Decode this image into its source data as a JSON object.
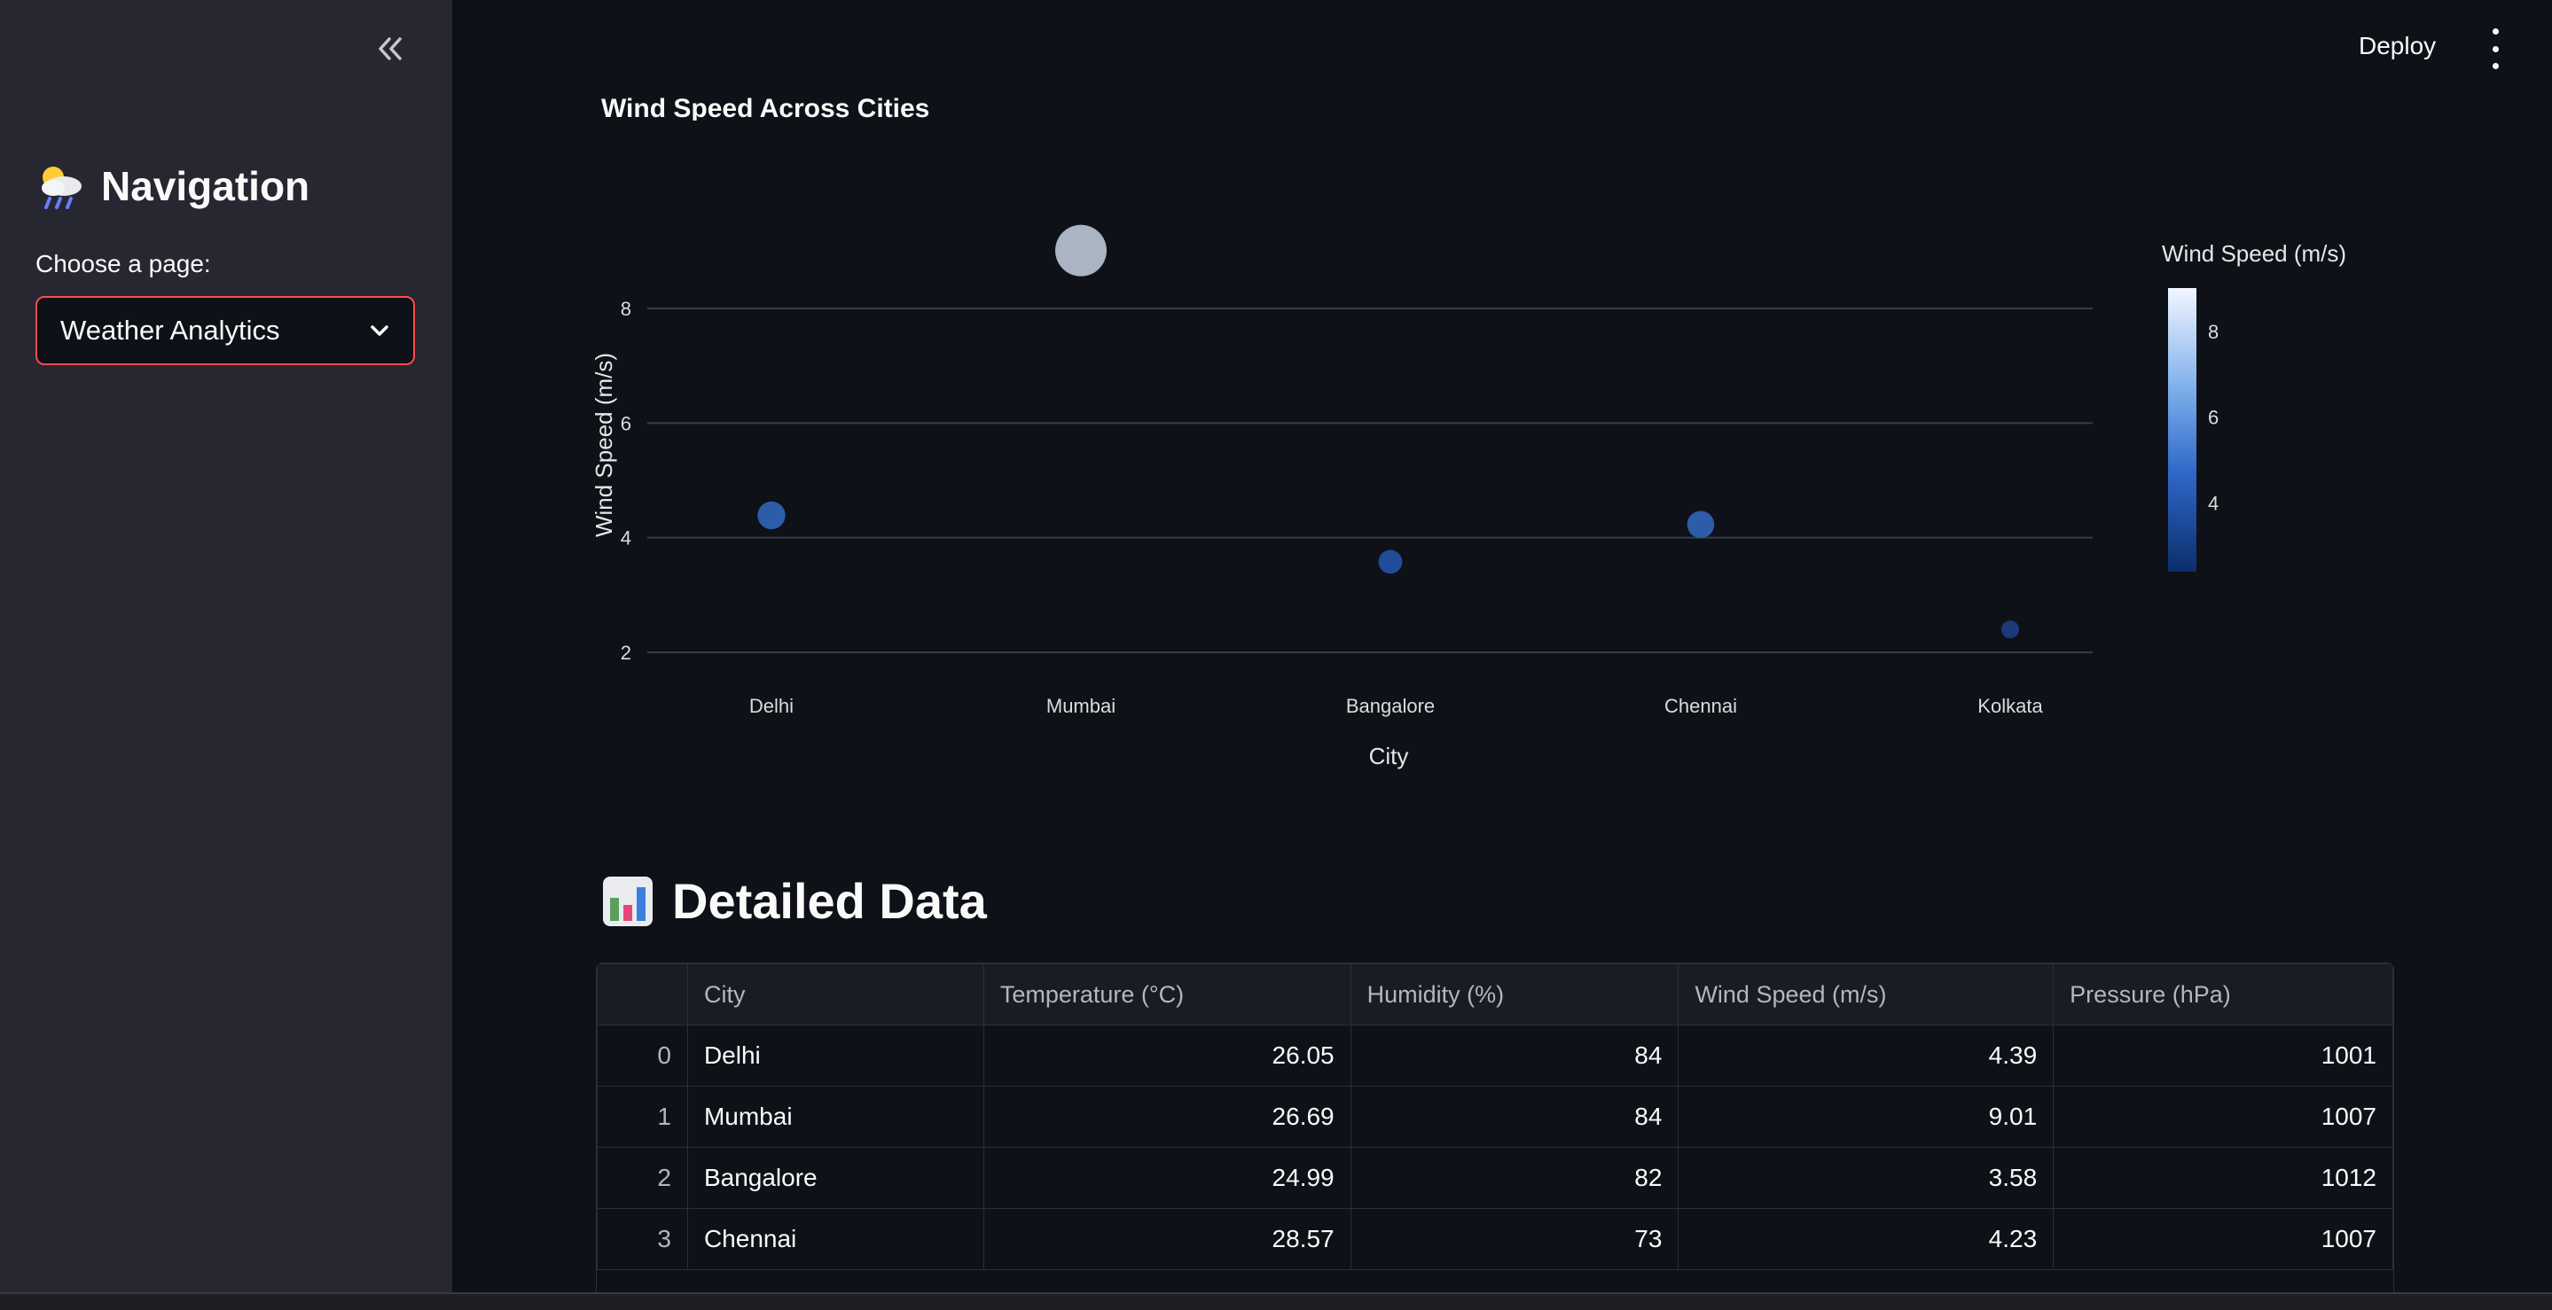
{
  "sidebar": {
    "title": "Navigation",
    "title_icon": "cloud-rain-emoji",
    "select_label": "Choose a page:",
    "select_value": "Weather Analytics"
  },
  "header": {
    "deploy_label": "Deploy"
  },
  "chart_data": {
    "type": "scatter",
    "title": "Wind Speed Across Cities",
    "xlabel": "City",
    "ylabel": "Wind Speed (m/s)",
    "categories": [
      "Delhi",
      "Mumbai",
      "Bangalore",
      "Chennai",
      "Kolkata"
    ],
    "values": [
      4.39,
      9.01,
      3.58,
      4.23,
      2.4
    ],
    "y_ticks": [
      2,
      4,
      6,
      8
    ],
    "ylim": [
      1.6,
      9.8
    ],
    "marker_size_by": "value",
    "colorbar": {
      "title": "Wind Speed (m/s)",
      "ticks": [
        4,
        6,
        8
      ],
      "range": [
        2.4,
        9.01
      ]
    },
    "grid": true
  },
  "section": {
    "title": "Detailed Data",
    "icon": "bar-chart-emoji"
  },
  "table": {
    "columns": [
      "",
      "City",
      "Temperature (°C)",
      "Humidity (%)",
      "Wind Speed (m/s)",
      "Pressure (hPa)"
    ],
    "rows": [
      [
        "0",
        "Delhi",
        "26.05",
        "84",
        "4.39",
        "1001"
      ],
      [
        "1",
        "Mumbai",
        "26.69",
        "84",
        "9.01",
        "1007"
      ],
      [
        "2",
        "Bangalore",
        "24.99",
        "82",
        "3.58",
        "1012"
      ],
      [
        "3",
        "Chennai",
        "28.57",
        "73",
        "4.23",
        "1007"
      ]
    ]
  }
}
